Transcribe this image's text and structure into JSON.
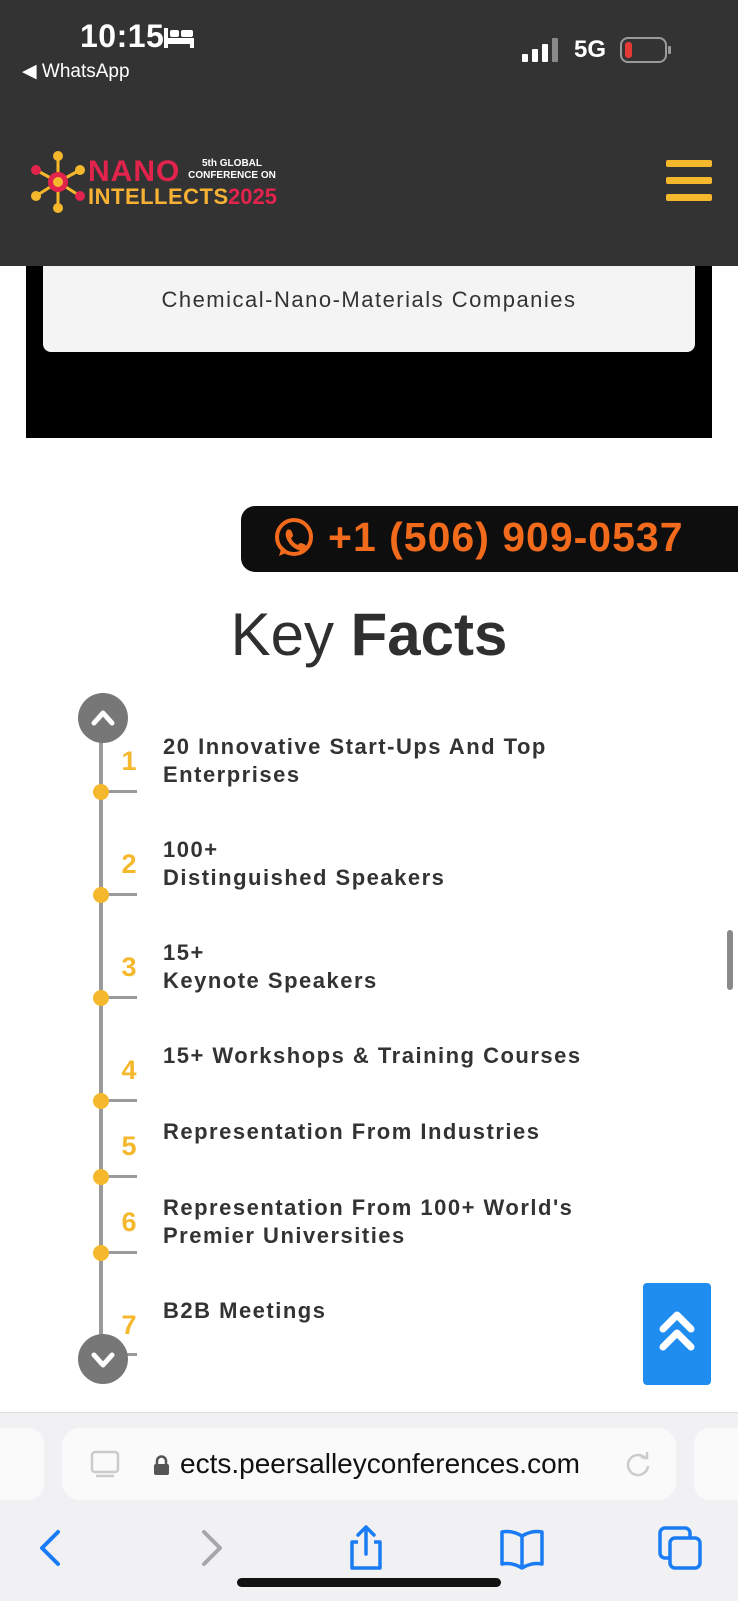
{
  "status_bar": {
    "time": "10:15",
    "back_app": "◀ WhatsApp",
    "network": "5G"
  },
  "header": {
    "logo_line1": "NANO",
    "logo_line2_part1": "INTELLECTS",
    "logo_line2_part2": "2025",
    "logo_tagline": "5th GLOBAL CONFERENCE ON",
    "menu_icon": "hamburger-icon"
  },
  "card": {
    "text": "Chemical-Nano-Materials Companies"
  },
  "phone_banner": {
    "number": "+1 (506) 909-0537",
    "icon": "whatsapp-icon"
  },
  "key_facts": {
    "title_light": "Key",
    "title_bold": "Facts",
    "items": [
      {
        "num": "1",
        "line1": "20 Innovative Start-Ups And Top",
        "line2": "Enterprises"
      },
      {
        "num": "2",
        "line1": "100+",
        "line2": "Distinguished Speakers"
      },
      {
        "num": "3",
        "line1": "15+",
        "line2": "Keynote Speakers"
      },
      {
        "num": "4",
        "line1": "15+ Workshops & Training Courses",
        "line2": ""
      },
      {
        "num": "5",
        "line1": "Representation From Industries",
        "line2": ""
      },
      {
        "num": "6",
        "line1": "Representation From 100+ World's",
        "line2": "Premier Universities"
      },
      {
        "num": "7",
        "line1": "B2B Meetings",
        "line2": ""
      }
    ]
  },
  "browser": {
    "url": "ects.peersalleyconferences.com"
  },
  "colors": {
    "header_bg": "#333333",
    "accent_yellow": "#f5b82c",
    "accent_orange": "#f26a1b",
    "brand_pink": "#e2244d",
    "scroll_button_blue": "#1f8cef"
  }
}
